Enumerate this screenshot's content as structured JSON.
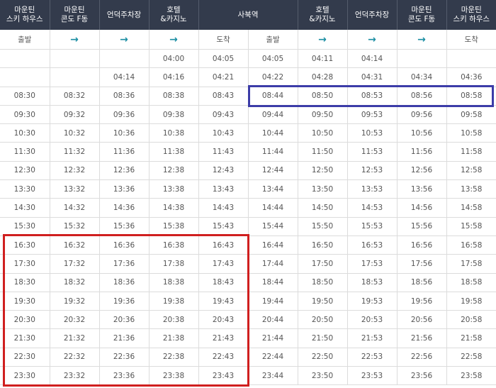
{
  "header": {
    "columns": [
      [
        "마운틴",
        "스키 하우스"
      ],
      [
        "마운틴",
        "콘도 F동"
      ],
      [
        "언덕주차장"
      ],
      [
        "호텔",
        "&카지노"
      ],
      [
        "사북역"
      ],
      [
        "호텔",
        "&카지노"
      ],
      [
        "언덕주차장"
      ],
      [
        "마운틴",
        "콘도 F동"
      ],
      [
        "마운틴",
        "스키 하우스"
      ]
    ]
  },
  "subheader": {
    "labels": [
      "출발",
      "→",
      "→",
      "→",
      "도착",
      "출발",
      "→",
      "→",
      "→",
      "도착"
    ],
    "arrow_icon": "right-arrow-icon",
    "arrow_color": "#1b8ea3"
  },
  "timetable": {
    "rows": [
      [
        "",
        "",
        "",
        "04:00",
        "04:05",
        "04:05",
        "04:11",
        "04:14",
        "",
        ""
      ],
      [
        "",
        "",
        "04:14",
        "04:16",
        "04:21",
        "04:22",
        "04:28",
        "04:31",
        "04:34",
        "04:36"
      ],
      [
        "08:30",
        "08:32",
        "08:36",
        "08:38",
        "08:43",
        "08:44",
        "08:50",
        "08:53",
        "08:56",
        "08:58"
      ],
      [
        "09:30",
        "09:32",
        "09:36",
        "09:38",
        "09:43",
        "09:44",
        "09:50",
        "09:53",
        "09:56",
        "09:58"
      ],
      [
        "10:30",
        "10:32",
        "10:36",
        "10:38",
        "10:43",
        "10:44",
        "10:50",
        "10:53",
        "10:56",
        "10:58"
      ],
      [
        "11:30",
        "11:32",
        "11:36",
        "11:38",
        "11:43",
        "11:44",
        "11:50",
        "11:53",
        "11:56",
        "11:58"
      ],
      [
        "12:30",
        "12:32",
        "12:36",
        "12:38",
        "12:43",
        "12:44",
        "12:50",
        "12:53",
        "12:56",
        "12:58"
      ],
      [
        "13:30",
        "13:32",
        "13:36",
        "13:38",
        "13:43",
        "13:44",
        "13:50",
        "13:53",
        "13:56",
        "13:58"
      ],
      [
        "14:30",
        "14:32",
        "14:36",
        "14:38",
        "14:43",
        "14:44",
        "14:50",
        "14:53",
        "14:56",
        "14:58"
      ],
      [
        "15:30",
        "15:32",
        "15:36",
        "15:38",
        "15:43",
        "15:44",
        "15:50",
        "15:53",
        "15:56",
        "15:58"
      ],
      [
        "16:30",
        "16:32",
        "16:36",
        "16:38",
        "16:43",
        "16:44",
        "16:50",
        "16:53",
        "16:56",
        "16:58"
      ],
      [
        "17:30",
        "17:32",
        "17:36",
        "17:38",
        "17:43",
        "17:44",
        "17:50",
        "17:53",
        "17:56",
        "17:58"
      ],
      [
        "18:30",
        "18:32",
        "18:36",
        "18:38",
        "18:43",
        "18:44",
        "18:50",
        "18:53",
        "18:56",
        "18:58"
      ],
      [
        "19:30",
        "19:32",
        "19:36",
        "19:38",
        "19:43",
        "19:44",
        "19:50",
        "19:53",
        "19:56",
        "19:58"
      ],
      [
        "20:30",
        "20:32",
        "20:36",
        "20:38",
        "20:43",
        "20:44",
        "20:50",
        "20:53",
        "20:56",
        "20:58"
      ],
      [
        "21:30",
        "21:32",
        "21:36",
        "21:38",
        "21:43",
        "21:44",
        "21:50",
        "21:53",
        "21:56",
        "21:58"
      ],
      [
        "22:30",
        "22:32",
        "22:36",
        "22:38",
        "22:43",
        "22:44",
        "22:50",
        "22:53",
        "22:56",
        "22:58"
      ],
      [
        "23:30",
        "23:32",
        "23:36",
        "23:38",
        "23:43",
        "23:44",
        "23:50",
        "23:53",
        "23:56",
        "23:58"
      ]
    ]
  },
  "highlights": {
    "blue_color": "#3c3ca8",
    "red_color": "#d01f1f"
  }
}
